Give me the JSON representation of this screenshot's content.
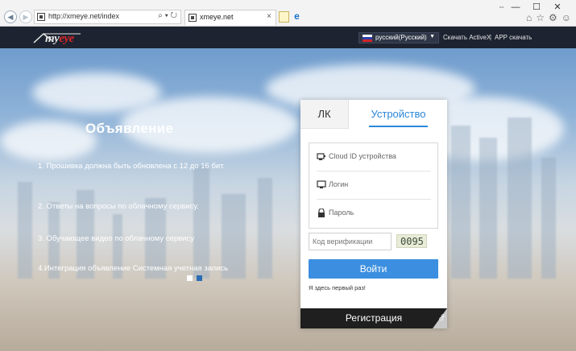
{
  "browser": {
    "url": "http://xmeye.net/index",
    "tab_title": "xmeye.net",
    "url_tools": "⌕ ▾ ↻",
    "window_controls": [
      "—",
      "☐",
      "✕"
    ],
    "drag": "⇔"
  },
  "header": {
    "logo_text_prefix": "my",
    "logo_text_accent": "eye",
    "language": "русский(Русский)",
    "download_activex": "Скачать ActiveX",
    "separator": "|",
    "app_download": "APP скачать"
  },
  "announcement": {
    "title": "Объявление",
    "items": [
      "1. Прошивка должна быть обновлена с 12 до 16 бит.",
      "2. Ответы на вопросы по облачному сервису.",
      "3. Обучающее видео по облачному сервису",
      "4.Интеграция объявление Системная учетная запись"
    ]
  },
  "login": {
    "tab_account": "ЛК",
    "tab_device": "Устройство",
    "cloud_id_placeholder": "Cloud ID устройства",
    "login_placeholder": "Логин",
    "password_placeholder": "Пароль",
    "captcha_placeholder": "Код верификации",
    "captcha_value": "0095",
    "login_button": "Войти",
    "first_time": "Я здесь первый раз!",
    "register_button": "Регистрация",
    "corner_label": "QR"
  },
  "colors": {
    "accent": "#2b87d8",
    "button": "#3c8fe0",
    "header": "#1d2330",
    "register": "#1f1f1f"
  },
  "icons": {
    "cloud_id": "device-icon",
    "login": "monitor-icon",
    "password": "lock-icon"
  }
}
